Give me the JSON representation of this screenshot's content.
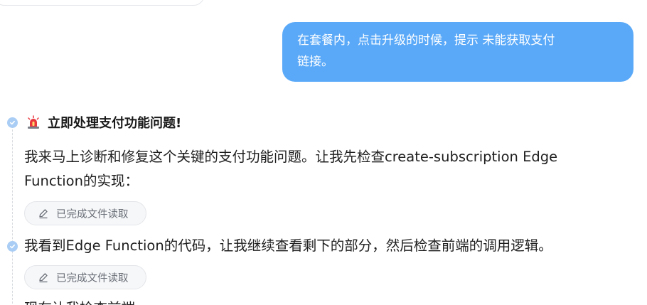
{
  "user_message": {
    "line1": "在套餐内，点击升级的时候，提示 未能获取支付",
    "line2": "链接。"
  },
  "assistant": {
    "heading_icon": "siren-icon",
    "heading": "立即处理支付功能问题!",
    "para1_line1": "我来马上诊断和修复这个关键的支付功能问题。让我先检查create-subscription Edge",
    "para1_line2": "Function的实现：",
    "chip1_icon": "edit-icon",
    "chip1_label": "已完成文件读取",
    "para2": "我看到Edge Function的代码，让我继续查看剩下的部分，然后检查前端的调用逻辑。",
    "chip2_icon": "edit-icon",
    "chip2_label": "已完成文件读取",
    "para3_partial": "现在让我检查前端"
  },
  "colors": {
    "user_bubble": "#5aa9f8",
    "timeline_dot": "#a9cdf4",
    "chip_bg": "#f6f7f9"
  }
}
